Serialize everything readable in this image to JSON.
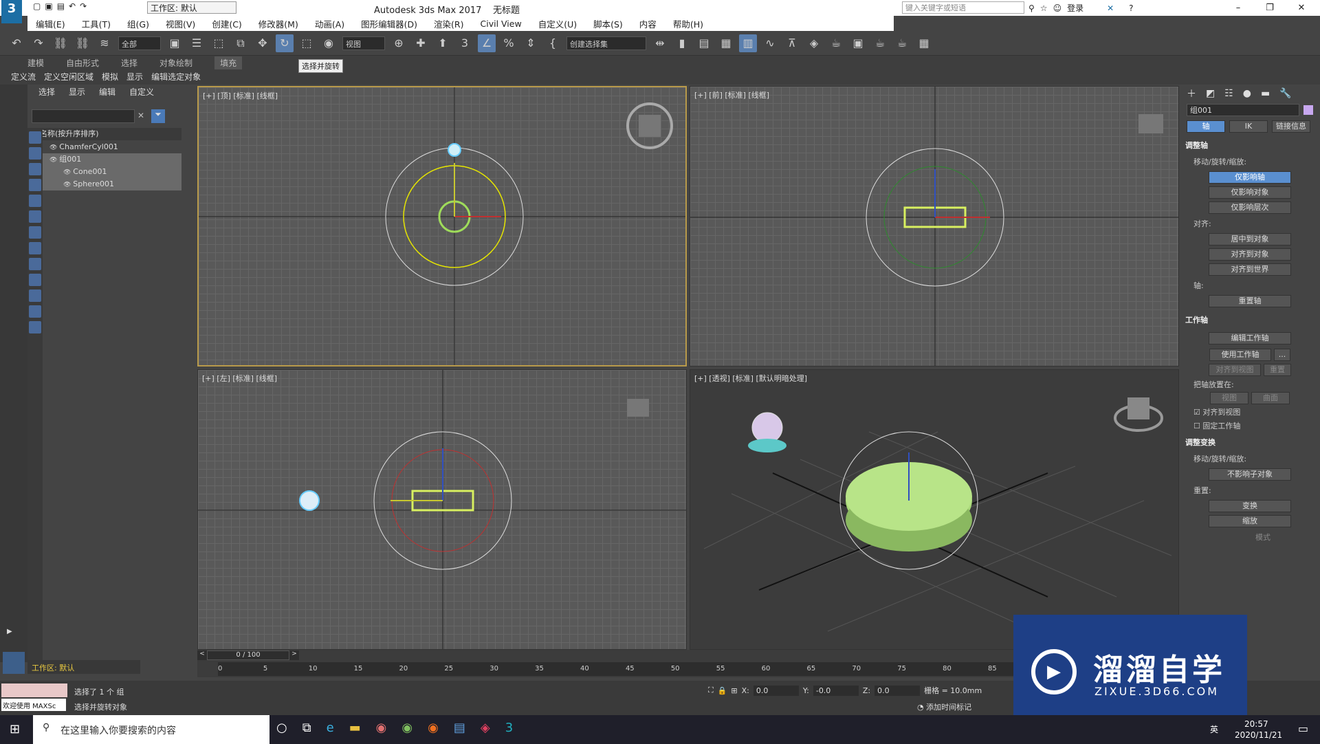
{
  "titlebar": {
    "workspace": "工作区: 默认",
    "app_title": "Autodesk 3ds Max 2017",
    "doc_title": "无标题",
    "search_placeholder": "键入关键字或短语",
    "login": "登录"
  },
  "menu": [
    "编辑(E)",
    "工具(T)",
    "组(G)",
    "视图(V)",
    "创建(C)",
    "修改器(M)",
    "动画(A)",
    "图形编辑器(D)",
    "渲染(R)",
    "Civil View",
    "自定义(U)",
    "脚本(S)",
    "内容",
    "帮助(H)"
  ],
  "toolbar": {
    "filter_combo": "全部",
    "ref_combo": "视图",
    "selset_combo": "创建选择集",
    "tooltip": "选择并旋转"
  },
  "ribbon": {
    "tabs": [
      "建模",
      "自由形式",
      "选择",
      "对象绘制",
      "填充"
    ],
    "active_tab": "填充",
    "subtabs": [
      "定义流",
      "定义空闲区域",
      "模拟",
      "显示",
      "编辑选定对象"
    ]
  },
  "scene_explorer": {
    "menu": [
      "选择",
      "显示",
      "编辑",
      "自定义"
    ],
    "header": "名称(按升序排序)",
    "items": [
      {
        "name": "ChamferCyl001",
        "indent": 0,
        "selected": false
      },
      {
        "name": "组001",
        "indent": 0,
        "selected": true
      },
      {
        "name": "Cone001",
        "indent": 1,
        "selected": true
      },
      {
        "name": "Sphere001",
        "indent": 1,
        "selected": true
      }
    ]
  },
  "viewports": [
    {
      "label": "[+] [顶] [标准] [线框]"
    },
    {
      "label": "[+] [前] [标准] [线框]"
    },
    {
      "label": "[+] [左] [标准] [线框]"
    },
    {
      "label": "[+] [透视] [标准] [默认明暗处理]"
    }
  ],
  "command_panel": {
    "object_name": "组001",
    "tabs": [
      "轴",
      "IK",
      "链接信息"
    ],
    "adjust_pivot": "调整轴",
    "move_rotate_scale": "移动/旋转/缩放:",
    "pivot_buttons": [
      "仅影响轴",
      "仅影响对象",
      "仅影响层次"
    ],
    "align_label": "对齐:",
    "align_buttons": [
      "居中到对象",
      "对齐到对象",
      "对齐到世界"
    ],
    "pivot_label": "轴:",
    "reset_pivot": "重置轴",
    "working_pivot": "工作轴",
    "edit_working_pivot": "编辑工作轴",
    "use_working_pivot": "使用工作轴",
    "more": "...",
    "align_to_view": "对齐到视图",
    "reset": "重置",
    "place_pivot_on": "把轴放置在:",
    "view": "视图",
    "surface": "曲面",
    "align_to_view_check": "对齐到视图",
    "fix_working_pivot": "固定工作轴",
    "adjust_transform": "调整变换",
    "move_rotate_scale2": "移动/旋转/缩放:",
    "dont_affect_children": "不影响子对象",
    "reset2": "重置:",
    "transform": "变换",
    "scale": "缩放",
    "mode": "模式"
  },
  "timeline": {
    "frame": "0 / 100",
    "ticks": [
      "0",
      "5",
      "10",
      "15",
      "20",
      "25",
      "30",
      "35",
      "40",
      "45",
      "50",
      "55",
      "60",
      "65",
      "70",
      "75",
      "80",
      "85"
    ]
  },
  "status": {
    "workspace": "工作区: 默认",
    "welcome": "欢迎使用 MAXSc",
    "selected": "选择了 1 个 组",
    "hint": "选择并旋转对象",
    "x_label": "X:",
    "x": "0.0",
    "y_label": "Y:",
    "y": "-0.0",
    "z_label": "Z:",
    "z": "0.0",
    "grid": "栅格 = 10.0mm",
    "add_time_tag": "添加时间标记"
  },
  "taskbar": {
    "search": "在这里输入你要搜索的内容",
    "time": "20:57",
    "date": "2020/11/21",
    "lang": "英"
  },
  "watermark": {
    "title": "溜溜自学",
    "url": "ZIXUE.3D66.COM"
  },
  "colors": {
    "accent": "#5a8fd0",
    "selection": "#ffff00",
    "object_green": "#a8d878"
  }
}
